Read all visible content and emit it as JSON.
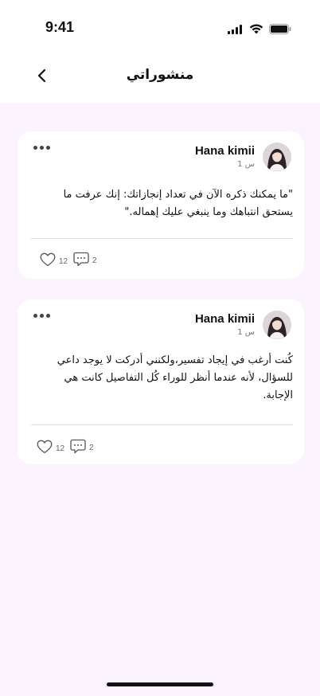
{
  "status_bar": {
    "time": "9:41",
    "icons": [
      "signal-icon",
      "wifi-icon",
      "battery-icon"
    ]
  },
  "header": {
    "title": "منشوراتي",
    "back_icon": "chevron-left-icon"
  },
  "posts": [
    {
      "author": "Hana kimii",
      "time_ago": "1 س",
      "text": "\"ما يمكنك ذكره الآن في تعداد إنجازاتك: إنك عرفت ما يستحق انتباهك وما ينبغي عليك إهماله.\"",
      "likes": "12",
      "comments": "2"
    },
    {
      "author": "Hana kimii",
      "time_ago": "1 س",
      "text": "كُنت أرغب في إيجاد تفسير،ولكنني أدركت لا يوجد داعي للسؤال، لأنه عندما أنظر للوراء كُل التفاصيل كانت هي الإجابة.",
      "likes": "12",
      "comments": "2"
    }
  ],
  "colors": {
    "background": "#fbf3fd",
    "card": "#ffffff",
    "text": "#111111"
  }
}
